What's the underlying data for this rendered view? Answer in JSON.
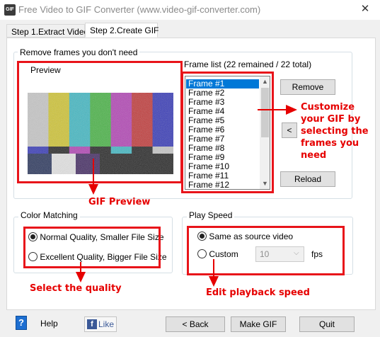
{
  "window": {
    "title": "Free Video to GIF Converter (www.video-gif-converter.com)",
    "app_icon_text": "GIF"
  },
  "tabs": [
    {
      "label": "Step 1.Extract Video"
    },
    {
      "label": "Step 2.Create GIF"
    }
  ],
  "remove_frames": {
    "legend": "Remove frames you don't need",
    "preview_label": "Preview",
    "frame_list_label": "Frame list (22 remained / 22 total)",
    "frames": [
      "Frame #1",
      "Frame #2",
      "Frame #3",
      "Frame #4",
      "Frame #5",
      "Frame #6",
      "Frame #7",
      "Frame #8",
      "Frame #9",
      "Frame #10",
      "Frame #11",
      "Frame #12"
    ],
    "selected_frame": "Frame #1",
    "remove_label": "Remove",
    "restore_label": "<",
    "reload_label": "Reload"
  },
  "color_matching": {
    "legend": "Color Matching",
    "option_normal": "Normal Quality, Smaller File Size",
    "option_excellent": "Excellent Quality, Bigger File Size",
    "selected": "option_normal"
  },
  "play_speed": {
    "legend": "Play Speed",
    "option_same": "Same as source video",
    "option_custom": "Custom",
    "custom_value": "10",
    "unit": "fps"
  },
  "annotations": {
    "customize": [
      "Customize",
      "your GIF by",
      "selecting the",
      "frames you",
      "need"
    ],
    "preview": "GIF Preview",
    "quality": "Select the quality",
    "speed": "Edit playback speed"
  },
  "bottom": {
    "help_label": "Help",
    "like_icon_letter": "f",
    "like_label": "Like",
    "back_label": "< Back",
    "make_label": "Make GIF",
    "quit_label": "Quit"
  },
  "colors": {
    "callout": "#e60000",
    "selection": "#0078d7"
  },
  "test_pattern": {
    "top_bars": [
      "#c8c8c8",
      "#d2c629",
      "#37b8c4",
      "#3fb33c",
      "#b23ab5",
      "#c22f2f",
      "#2c2fb8"
    ],
    "middle_bars": [
      "#2c2fb8",
      "#1a1a1a",
      "#b23ab5",
      "#1a1a1a",
      "#37b8c4",
      "#1a1a1a",
      "#c8c8c8"
    ],
    "bottom_blocks": [
      "#1e2b55",
      "#e8e8e8",
      "#3a1f5c",
      "#1a1a1a",
      "#1a1a1a",
      "#1a1a1a"
    ]
  }
}
